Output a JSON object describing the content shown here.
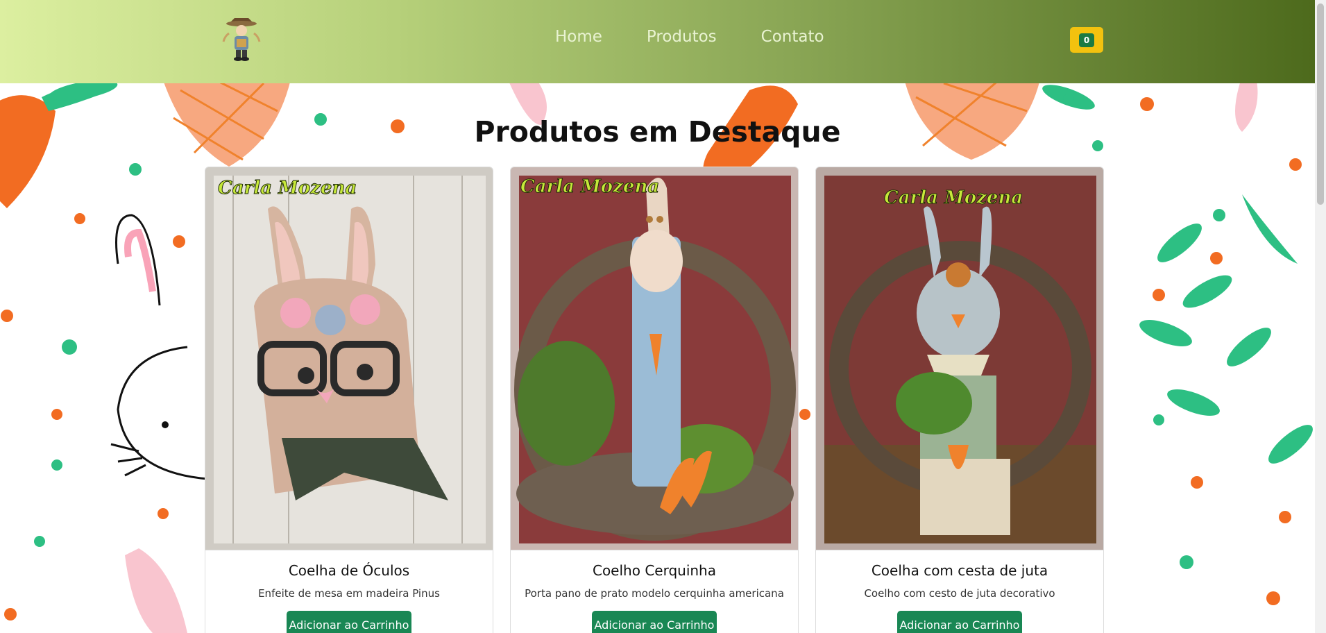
{
  "navbar": {
    "logo_icon": "scarecrow-doll-logo",
    "links": [
      {
        "label": "Home"
      },
      {
        "label": "Produtos"
      },
      {
        "label": "Contato"
      }
    ],
    "cart_count": "0"
  },
  "main": {
    "section_title": "Produtos em Destaque",
    "products": [
      {
        "watermark": "Carla Mozena",
        "title": "Coelha de Óculos",
        "description": "Enfeite de mesa em madeira Pinus",
        "button_label": "Adicionar ao Carrinho"
      },
      {
        "watermark": "Carla Mozena",
        "title": "Coelho Cerquinha",
        "description": "Porta pano de prato modelo cerquinha americana",
        "button_label": "Adicionar ao Carrinho"
      },
      {
        "watermark": "Carla Mozena",
        "title": "Coelha com cesta de juta",
        "description": "Coelho com cesto de juta decorativo",
        "button_label": "Adicionar ao Carrinho"
      }
    ]
  },
  "colors": {
    "accent": "#198754",
    "cart": "#f3c20f",
    "header_start": "#dcefa0",
    "header_end": "#4d6a1c"
  }
}
